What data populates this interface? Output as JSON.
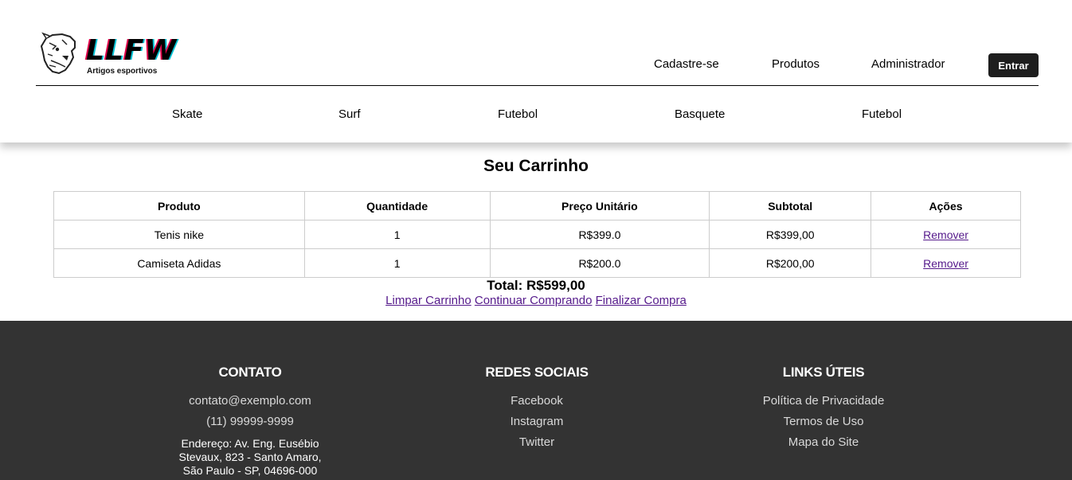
{
  "brand": {
    "name": "LLFW",
    "tagline": "Artigos esportivos"
  },
  "nav": {
    "items": [
      {
        "label": "Cadastre-se"
      },
      {
        "label": "Produtos"
      },
      {
        "label": "Administrador"
      }
    ],
    "login_label": "Entrar"
  },
  "categories": [
    "Skate",
    "Surf",
    "Futebol",
    "Basquete",
    "Futebol"
  ],
  "cart": {
    "title": "Seu Carrinho",
    "columns": [
      "Produto",
      "Quantidade",
      "Preço Unitário",
      "Subtotal",
      "Ações"
    ],
    "rows": [
      {
        "product": "Tenis nike",
        "quantity": "1",
        "unit_price": "R$399.0",
        "subtotal": "R$399,00",
        "action": "Remover"
      },
      {
        "product": "Camiseta Adidas",
        "quantity": "1",
        "unit_price": "R$200.0",
        "subtotal": "R$200,00",
        "action": "Remover"
      }
    ],
    "total": "Total: R$599,00",
    "actions": {
      "clear": "Limpar Carrinho",
      "continue": "Continuar Comprando",
      "checkout": "Finalizar Compra"
    }
  },
  "footer": {
    "contact": {
      "heading": "CONTATO",
      "email": "contato@exemplo.com",
      "phone": "(11) 99999-9999",
      "address_lines": [
        "Endereço: Av. Eng. Eusébio",
        "Stevaux, 823 - Santo Amaro,",
        "São Paulo - SP, 04696-000"
      ]
    },
    "social": {
      "heading": "REDES SOCIAIS",
      "links": [
        "Facebook",
        "Instagram",
        "Twitter"
      ]
    },
    "useful": {
      "heading": "LINKS ÚTEIS",
      "links": [
        "Política de Privacidade",
        "Termos de Uso",
        "Mapa do Site"
      ]
    }
  },
  "colors": {
    "header_bg": "#ffffff",
    "footer_bg": "#333333",
    "button_bg": "#1e1e1e",
    "visited_link": "#551a8b"
  }
}
